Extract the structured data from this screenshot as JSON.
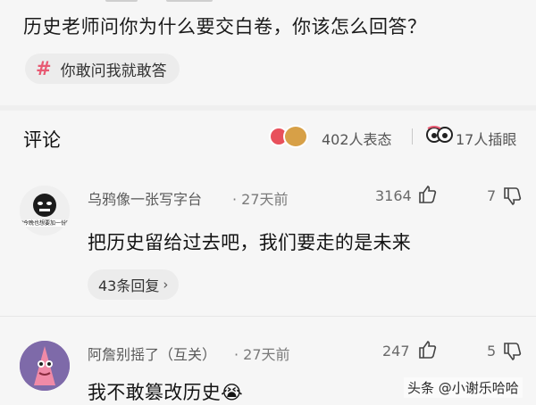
{
  "question": {
    "title": "历史老师问你为什么要交白卷，你该怎么回答？"
  },
  "topic": {
    "hash": "#",
    "label": "你敢问我就敢答"
  },
  "comments_header": {
    "title": "评论",
    "reactions_text": "402人表态",
    "eye_text": "17人插眼"
  },
  "comments": [
    {
      "username": "乌鸦像一张写字台",
      "time": "· 27天前",
      "likes": "3164",
      "dislikes": "7",
      "text": "把历史留给过去吧，我们要走的是未来",
      "reply": "43条回复",
      "avatar_text": "你今晚也想要加一份吗"
    },
    {
      "username": "阿詹别摇了（互关）",
      "time": "· 27天前",
      "likes": "247",
      "dislikes": "5",
      "text": "我不敢篡改历史😭"
    }
  ],
  "watermark": "头条 @小谢乐哈哈",
  "colors": {
    "accent": "#e85a73",
    "background": "#f6f6f6"
  },
  "icons": [
    "hash-icon",
    "reaction-icons",
    "eye-icon",
    "thumbs-up-icon",
    "thumbs-down-icon",
    "chevron-right-icon"
  ]
}
